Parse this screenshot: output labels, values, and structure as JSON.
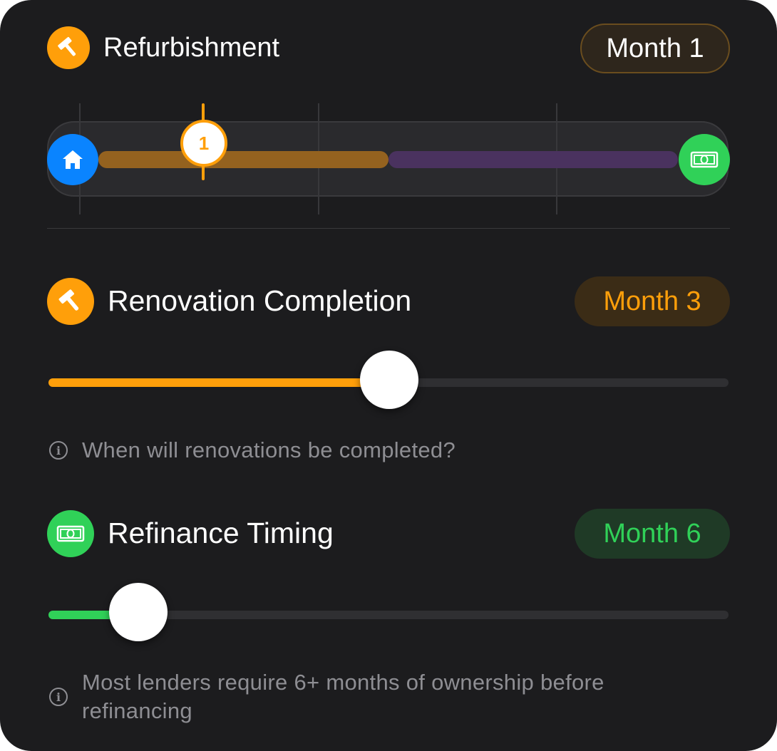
{
  "refurbishment": {
    "title": "Refurbishment",
    "badge": "Month 1",
    "icon": "hammer-icon",
    "timeline": {
      "marker_label": "1",
      "start_icon": "house-icon",
      "end_icon": "banknote-icon"
    }
  },
  "renovation": {
    "title": "Renovation Completion",
    "badge": "Month 3",
    "icon": "hammer-icon",
    "help_text": "When will renovations be completed?"
  },
  "refinance": {
    "title": "Refinance Timing",
    "badge": "Month 6",
    "icon": "banknote-icon",
    "help_text": "Most lenders require 6+ months of ownership before refinancing"
  },
  "colors": {
    "background": "#1c1c1e",
    "orange": "#ff9f0a",
    "green": "#30d158",
    "blue": "#0a84ff",
    "purple": "#4a325f",
    "muted_text": "#8e8e93"
  }
}
